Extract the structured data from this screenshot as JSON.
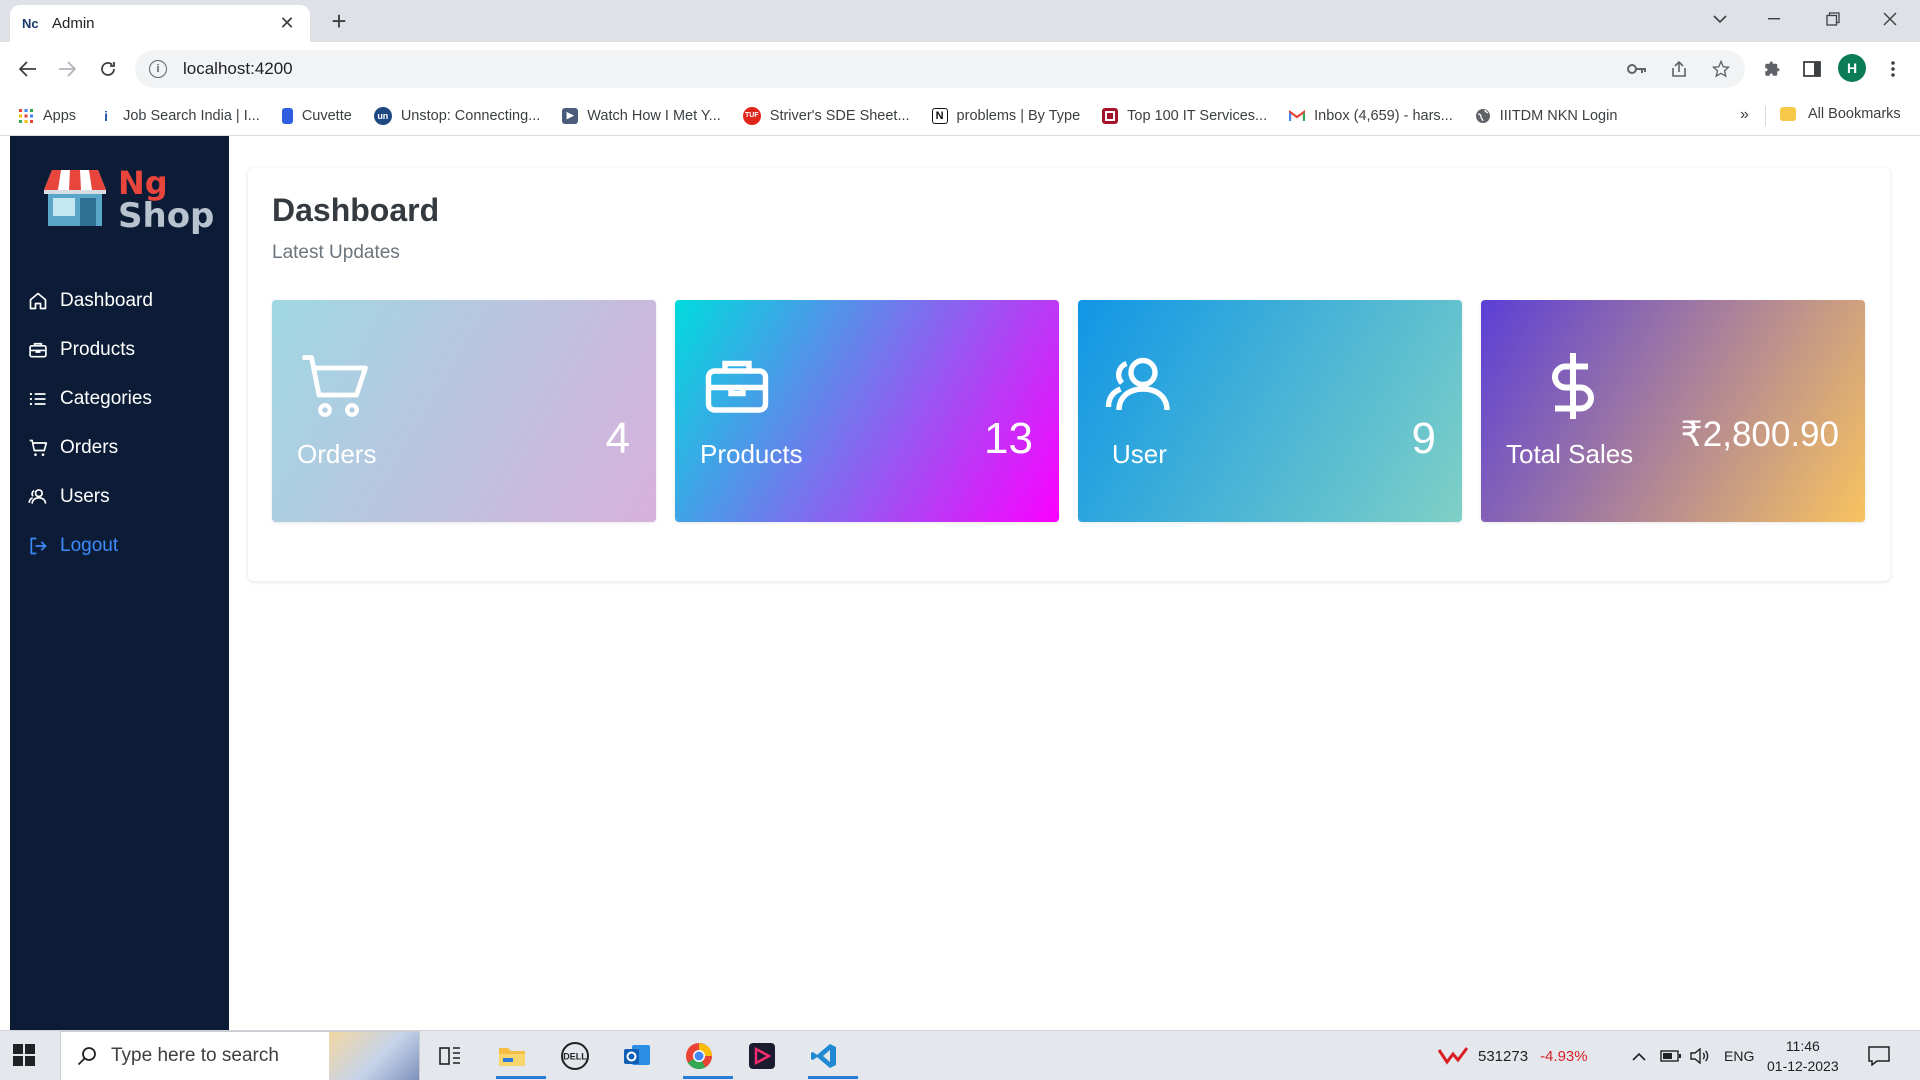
{
  "browser": {
    "tab_title": "Admin",
    "tab_favicon": "Nc",
    "url": "localhost:4200",
    "profile_initial": "H",
    "bookmarks": [
      {
        "label": "Apps",
        "icon": "apps-grid-icon"
      },
      {
        "label": "Job Search India | I...",
        "icon": "indeed-icon"
      },
      {
        "label": "Cuvette",
        "icon": "cuvette-icon"
      },
      {
        "label": "Unstop: Connecting...",
        "icon": "unstop-icon"
      },
      {
        "label": "Watch How I Met Y...",
        "icon": "video-icon"
      },
      {
        "label": "Striver's SDE Sheet...",
        "icon": "tuf-icon"
      },
      {
        "label": "problems | By Type",
        "icon": "notion-icon"
      },
      {
        "label": "Top 100 IT Services...",
        "icon": "site-icon"
      },
      {
        "label": "Inbox (4,659) - hars...",
        "icon": "gmail-icon"
      },
      {
        "label": "IIITDM NKN Login",
        "icon": "globe-icon"
      }
    ],
    "all_bookmarks": "All Bookmarks"
  },
  "logo": {
    "line1": "Ng",
    "line2": "Shop"
  },
  "sidebar": {
    "items": [
      {
        "label": "Dashboard",
        "icon": "home-icon"
      },
      {
        "label": "Products",
        "icon": "briefcase-icon"
      },
      {
        "label": "Categories",
        "icon": "list-icon"
      },
      {
        "label": "Orders",
        "icon": "cart-icon"
      },
      {
        "label": "Users",
        "icon": "users-icon"
      },
      {
        "label": "Logout",
        "icon": "logout-icon"
      }
    ]
  },
  "dashboard": {
    "title": "Dashboard",
    "subtitle": "Latest Updates",
    "cards": [
      {
        "label": "Orders",
        "value": "4",
        "icon": "cart-icon",
        "gradient": [
          "#9fd8e3",
          "#d8b0dc"
        ]
      },
      {
        "label": "Products",
        "value": "13",
        "icon": "briefcase-icon",
        "gradient": [
          "#00dbde",
          "#fc00ff"
        ]
      },
      {
        "label": "User",
        "value": "9",
        "icon": "users-icon",
        "gradient": [
          "#1096e6",
          "#7fd0c6"
        ]
      },
      {
        "label": "Total Sales",
        "value": "₹2,800.90",
        "icon": "dollar-icon",
        "gradient": [
          "#5b3fd6",
          "#f8c35f"
        ]
      }
    ]
  },
  "taskbar": {
    "search_placeholder": "Type here to search",
    "stock_value": "531273",
    "stock_change": "-4.93%",
    "language": "ENG",
    "time": "11:46",
    "date": "01-12-2023"
  }
}
